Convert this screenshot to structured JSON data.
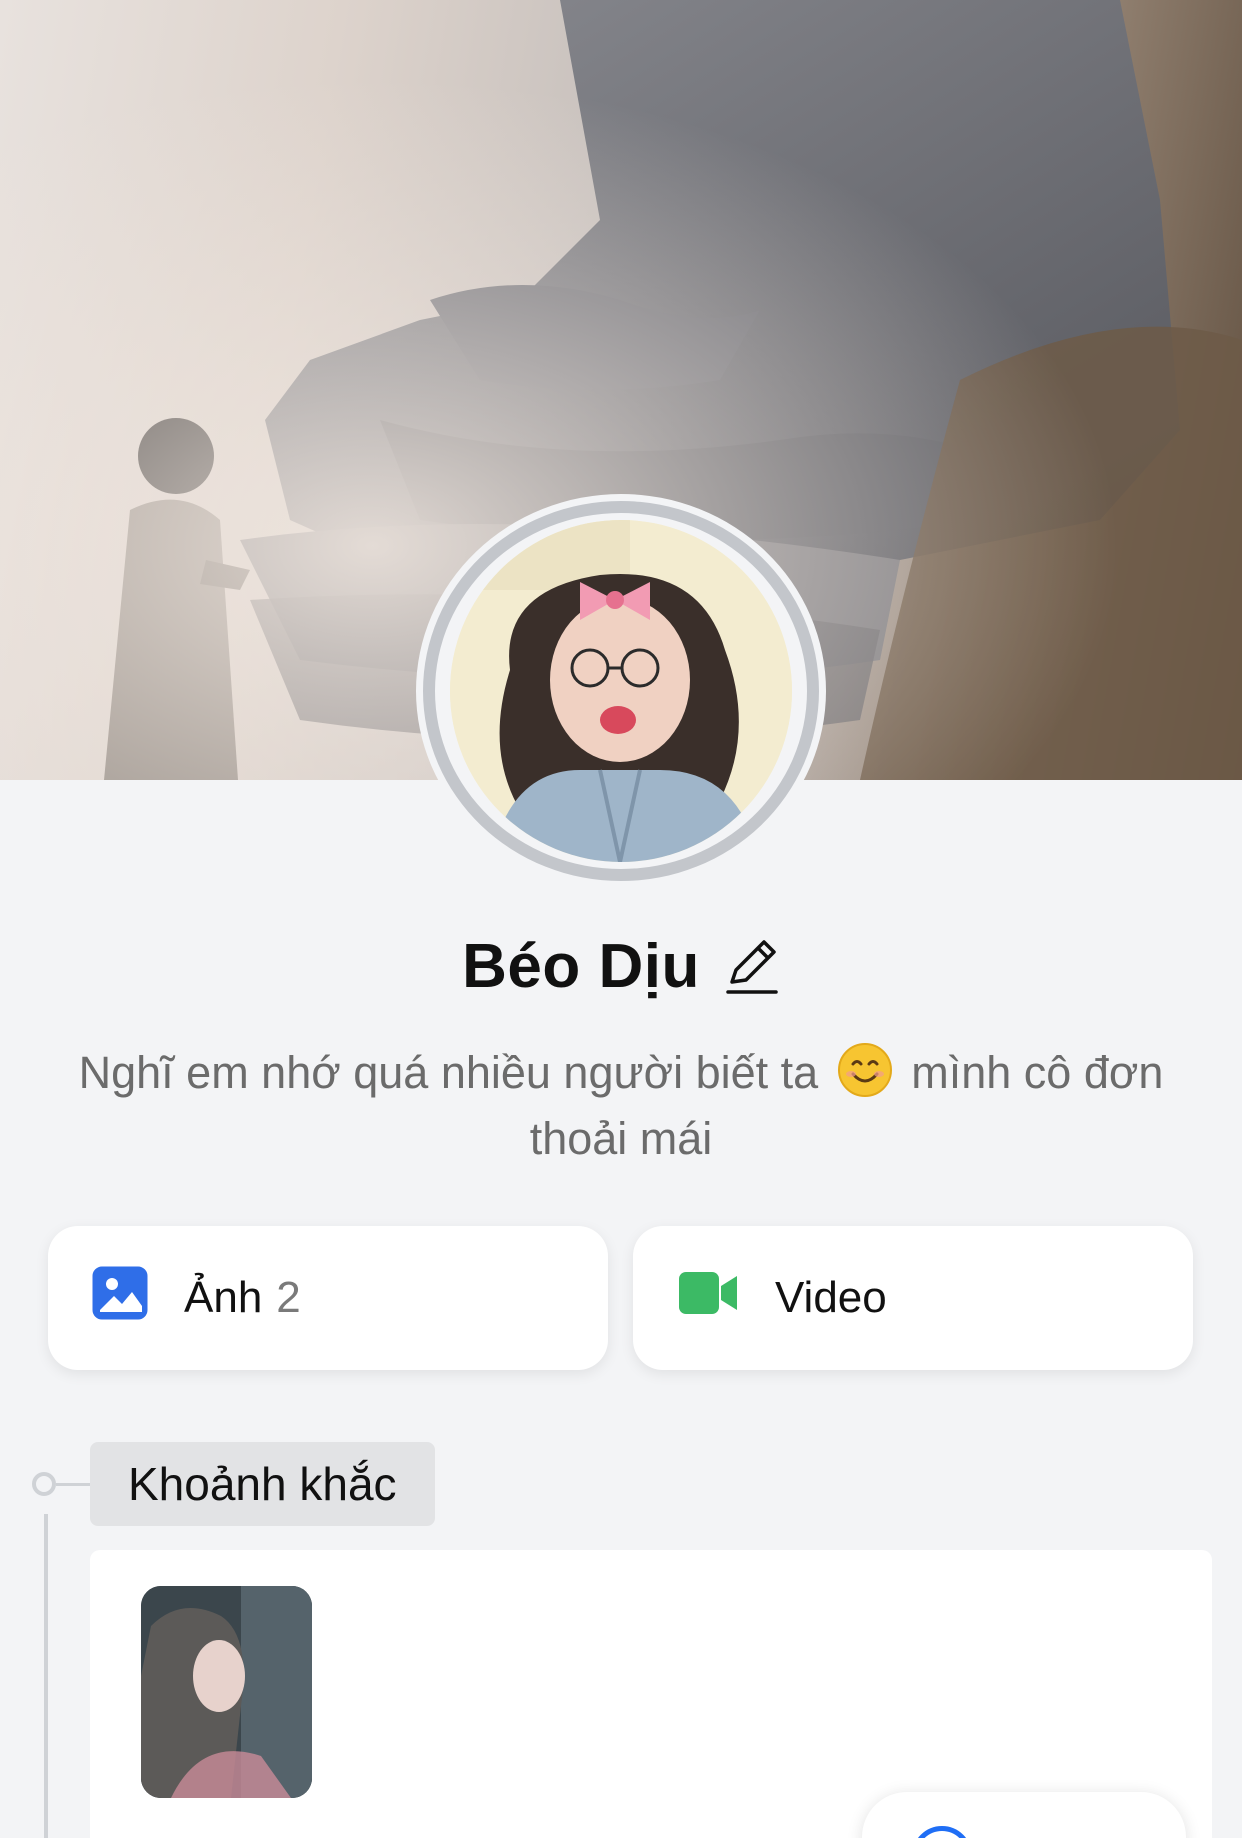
{
  "profile": {
    "name": "Béo Dịu",
    "bio_before_emoji": "Nghĩ em nhớ quá nhiều người biết ta",
    "bio_after_emoji": "mình cô đơn thoải mái"
  },
  "media": {
    "photos_label": "Ảnh",
    "photos_count": "2",
    "video_label": "Video",
    "photo_icon_color": "#2f6ee8",
    "video_icon_color": "#3cba65"
  },
  "timeline": {
    "section_label": "Khoảnh khắc"
  },
  "icons": {
    "edit": "pencil-icon",
    "photo": "image-icon",
    "video": "video-camera-icon",
    "emoji": "smiling-face-emoji"
  }
}
